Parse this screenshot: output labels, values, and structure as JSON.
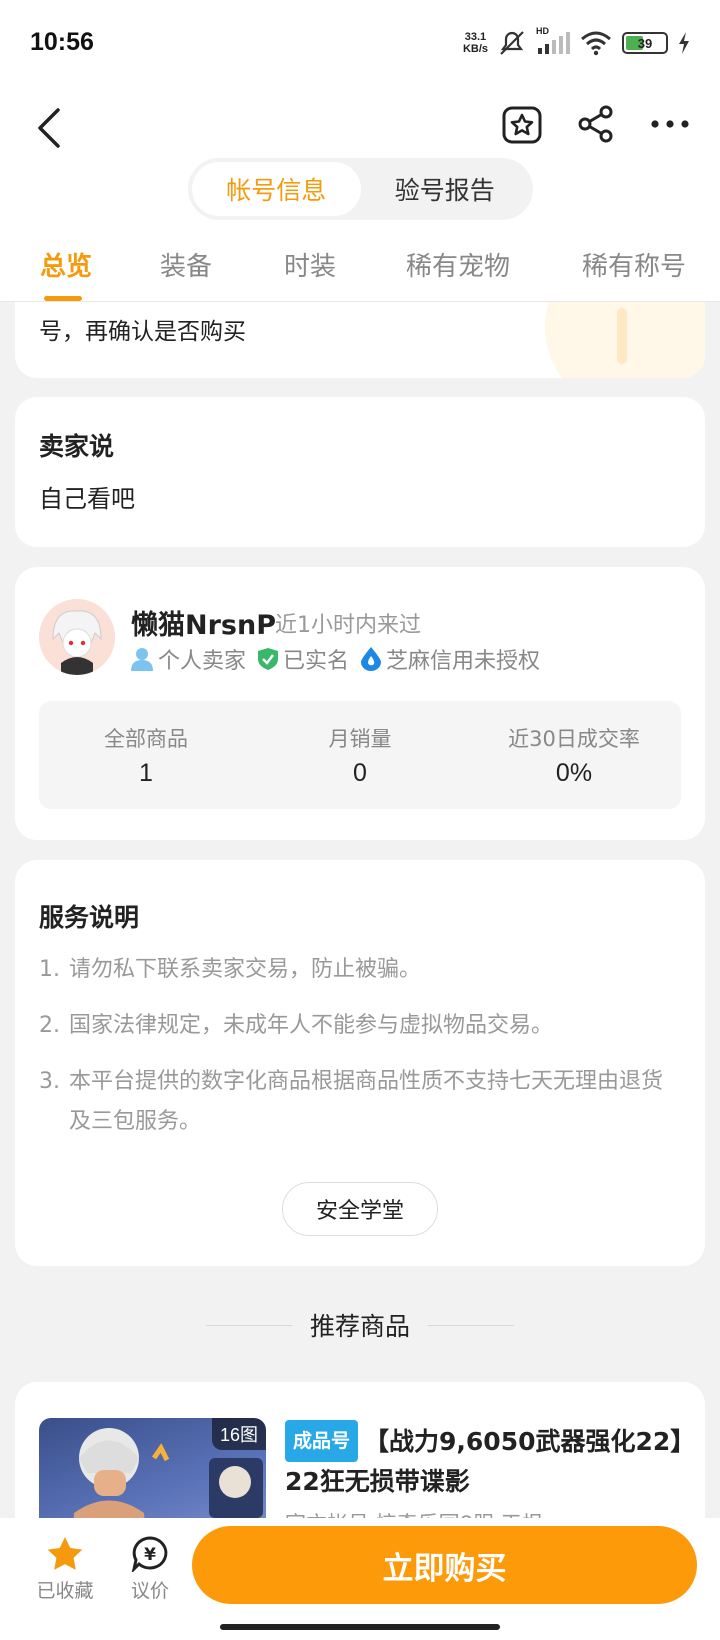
{
  "status_bar": {
    "time": "10:56",
    "net_speed_value": "33.1",
    "net_speed_unit": "KB/s",
    "signal_label": "HD",
    "battery": "39"
  },
  "header": {
    "segments": [
      "帐号信息",
      "验号报告"
    ],
    "active_segment": 0
  },
  "tabs": [
    "总览",
    "装备",
    "时装",
    "稀有宠物",
    "稀有称号"
  ],
  "notice": {
    "text": "号，再确认是否购买"
  },
  "seller_say": {
    "title": "卖家说",
    "body": "自己看吧"
  },
  "shop": {
    "name": "懒猫NrsnP",
    "last_seen": "近1小时内来过",
    "tags": [
      "个人卖家",
      "已实名",
      "芝麻信用未授权"
    ],
    "stats": [
      {
        "label": "全部商品",
        "value": "1"
      },
      {
        "label": "月销量",
        "value": "0"
      },
      {
        "label": "近30日成交率",
        "value": "0%"
      }
    ]
  },
  "service": {
    "title": "服务说明",
    "items": [
      {
        "num": "1.",
        "text": "请勿私下联系卖家交易，防止被骗。"
      },
      {
        "num": "2.",
        "text": "国家法律规定，未成年人不能参与虚拟物品交易。"
      },
      {
        "num": "3.",
        "text": "本平台提供的数字化商品根据商品性质不支持七天无理由退货及三包服务。"
      }
    ],
    "button": "安全学堂"
  },
  "recommend": {
    "title": "推荐商品",
    "item": {
      "image_count": "16图",
      "badge": "成品号",
      "name": "【战力9,6050武器强化22】22狂无损带谍影",
      "sub": "官方帐号 惊奇乐园8服 天报"
    }
  },
  "bottom": {
    "favorite_label": "已收藏",
    "bargain_label": "议价",
    "buy_label": "立即购买"
  },
  "colors": {
    "accent": "#f59a0c",
    "buy_button": "#fd9a0a",
    "badge": "#29a8e8"
  }
}
